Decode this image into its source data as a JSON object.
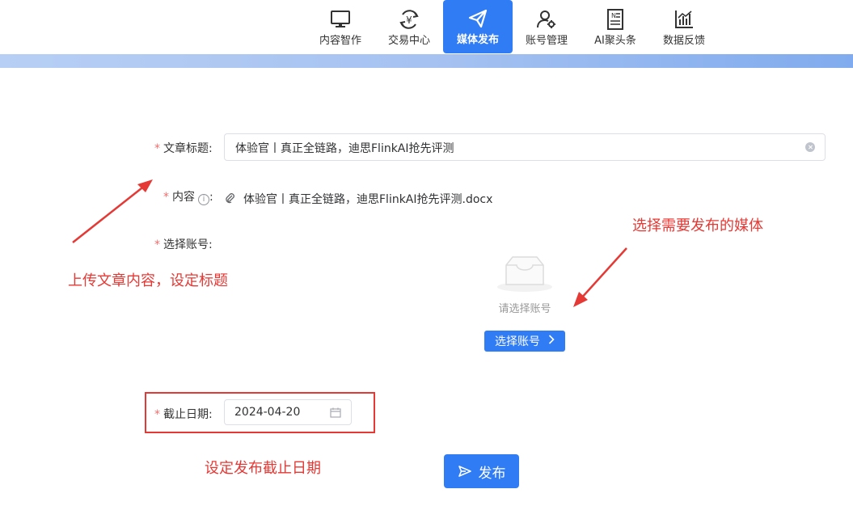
{
  "nav": {
    "items": [
      {
        "label": "内容智作",
        "icon": "monitor-icon"
      },
      {
        "label": "交易中心",
        "icon": "yuan-exchange-icon"
      },
      {
        "label": "媒体发布",
        "icon": "paper-plane-icon",
        "active": true
      },
      {
        "label": "账号管理",
        "icon": "user-settings-icon"
      },
      {
        "label": "AI聚头条",
        "icon": "newspaper-icon"
      },
      {
        "label": "数据反馈",
        "icon": "bar-chart-icon"
      }
    ],
    "active_color": "#2f7cf5"
  },
  "form": {
    "title_label": "文章标题:",
    "title_value": "体验官丨真正全链路，迪思FlinkAI抢先评测",
    "content_label": "内容",
    "content_info": "i",
    "content_colon": ":",
    "content_file": "体验官丨真正全链路，迪思FlinkAI抢先评测.docx",
    "account_label": "选择账号:",
    "account_empty_text": "请选择账号",
    "account_button": "选择账号",
    "deadline_label": "截止日期:",
    "deadline_value": "2024-04-20",
    "required_mark": "*",
    "publish_button": "发布"
  },
  "annotations": {
    "upload_note": "上传文章内容，设定标题",
    "media_note": "选择需要发布的媒体",
    "deadline_note": "设定发布截止日期",
    "color": "#e53935"
  }
}
